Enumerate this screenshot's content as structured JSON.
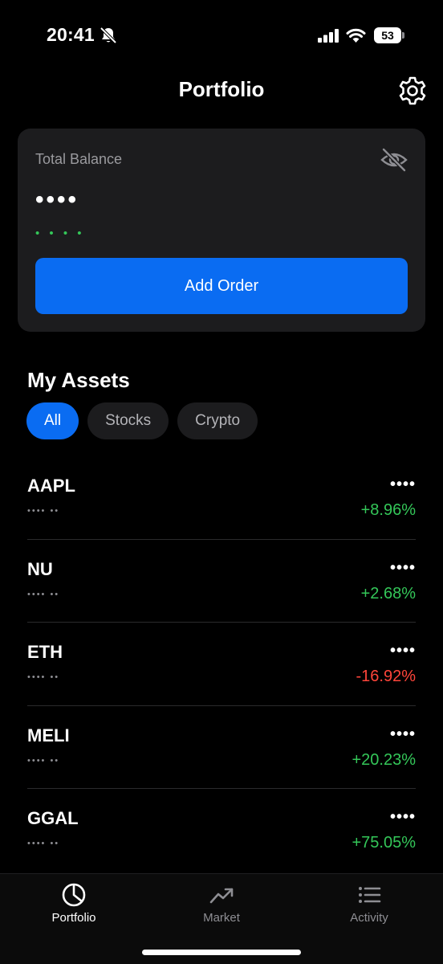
{
  "status_bar": {
    "time": "20:41",
    "battery_level": "53"
  },
  "header": {
    "title": "Portfolio",
    "settings_icon": "gear-icon"
  },
  "balance_card": {
    "label": "Total Balance",
    "value": "••••",
    "change": "• • • •",
    "visibility_icon": "eye-slash-icon",
    "add_order_label": "Add Order"
  },
  "assets": {
    "title": "My Assets",
    "filters": [
      {
        "label": "All",
        "active": true
      },
      {
        "label": "Stocks",
        "active": false
      },
      {
        "label": "Crypto",
        "active": false
      }
    ],
    "items": [
      {
        "symbol": "AAPL",
        "sub": "•••• ••",
        "value": "••••",
        "change": "+8.96%"
      },
      {
        "symbol": "NU",
        "sub": "•••• ••",
        "value": "••••",
        "change": "+2.68%"
      },
      {
        "symbol": "ETH",
        "sub": "•••• ••",
        "value": "••••",
        "change": "-16.92%"
      },
      {
        "symbol": "MELI",
        "sub": "•••• ••",
        "value": "••••",
        "change": "+20.23%"
      },
      {
        "symbol": "GGAL",
        "sub": "•••• ••",
        "value": "••••",
        "change": "+75.05%"
      }
    ]
  },
  "tab_bar": {
    "tabs": [
      {
        "label": "Portfolio",
        "icon": "pie-chart-icon",
        "active": true
      },
      {
        "label": "Market",
        "icon": "trending-up-icon",
        "active": false
      },
      {
        "label": "Activity",
        "icon": "list-icon",
        "active": false
      }
    ]
  },
  "colors": {
    "accent": "#0a6cf2",
    "positive": "#34c759",
    "negative": "#ff453a",
    "card": "#1c1c1e"
  }
}
